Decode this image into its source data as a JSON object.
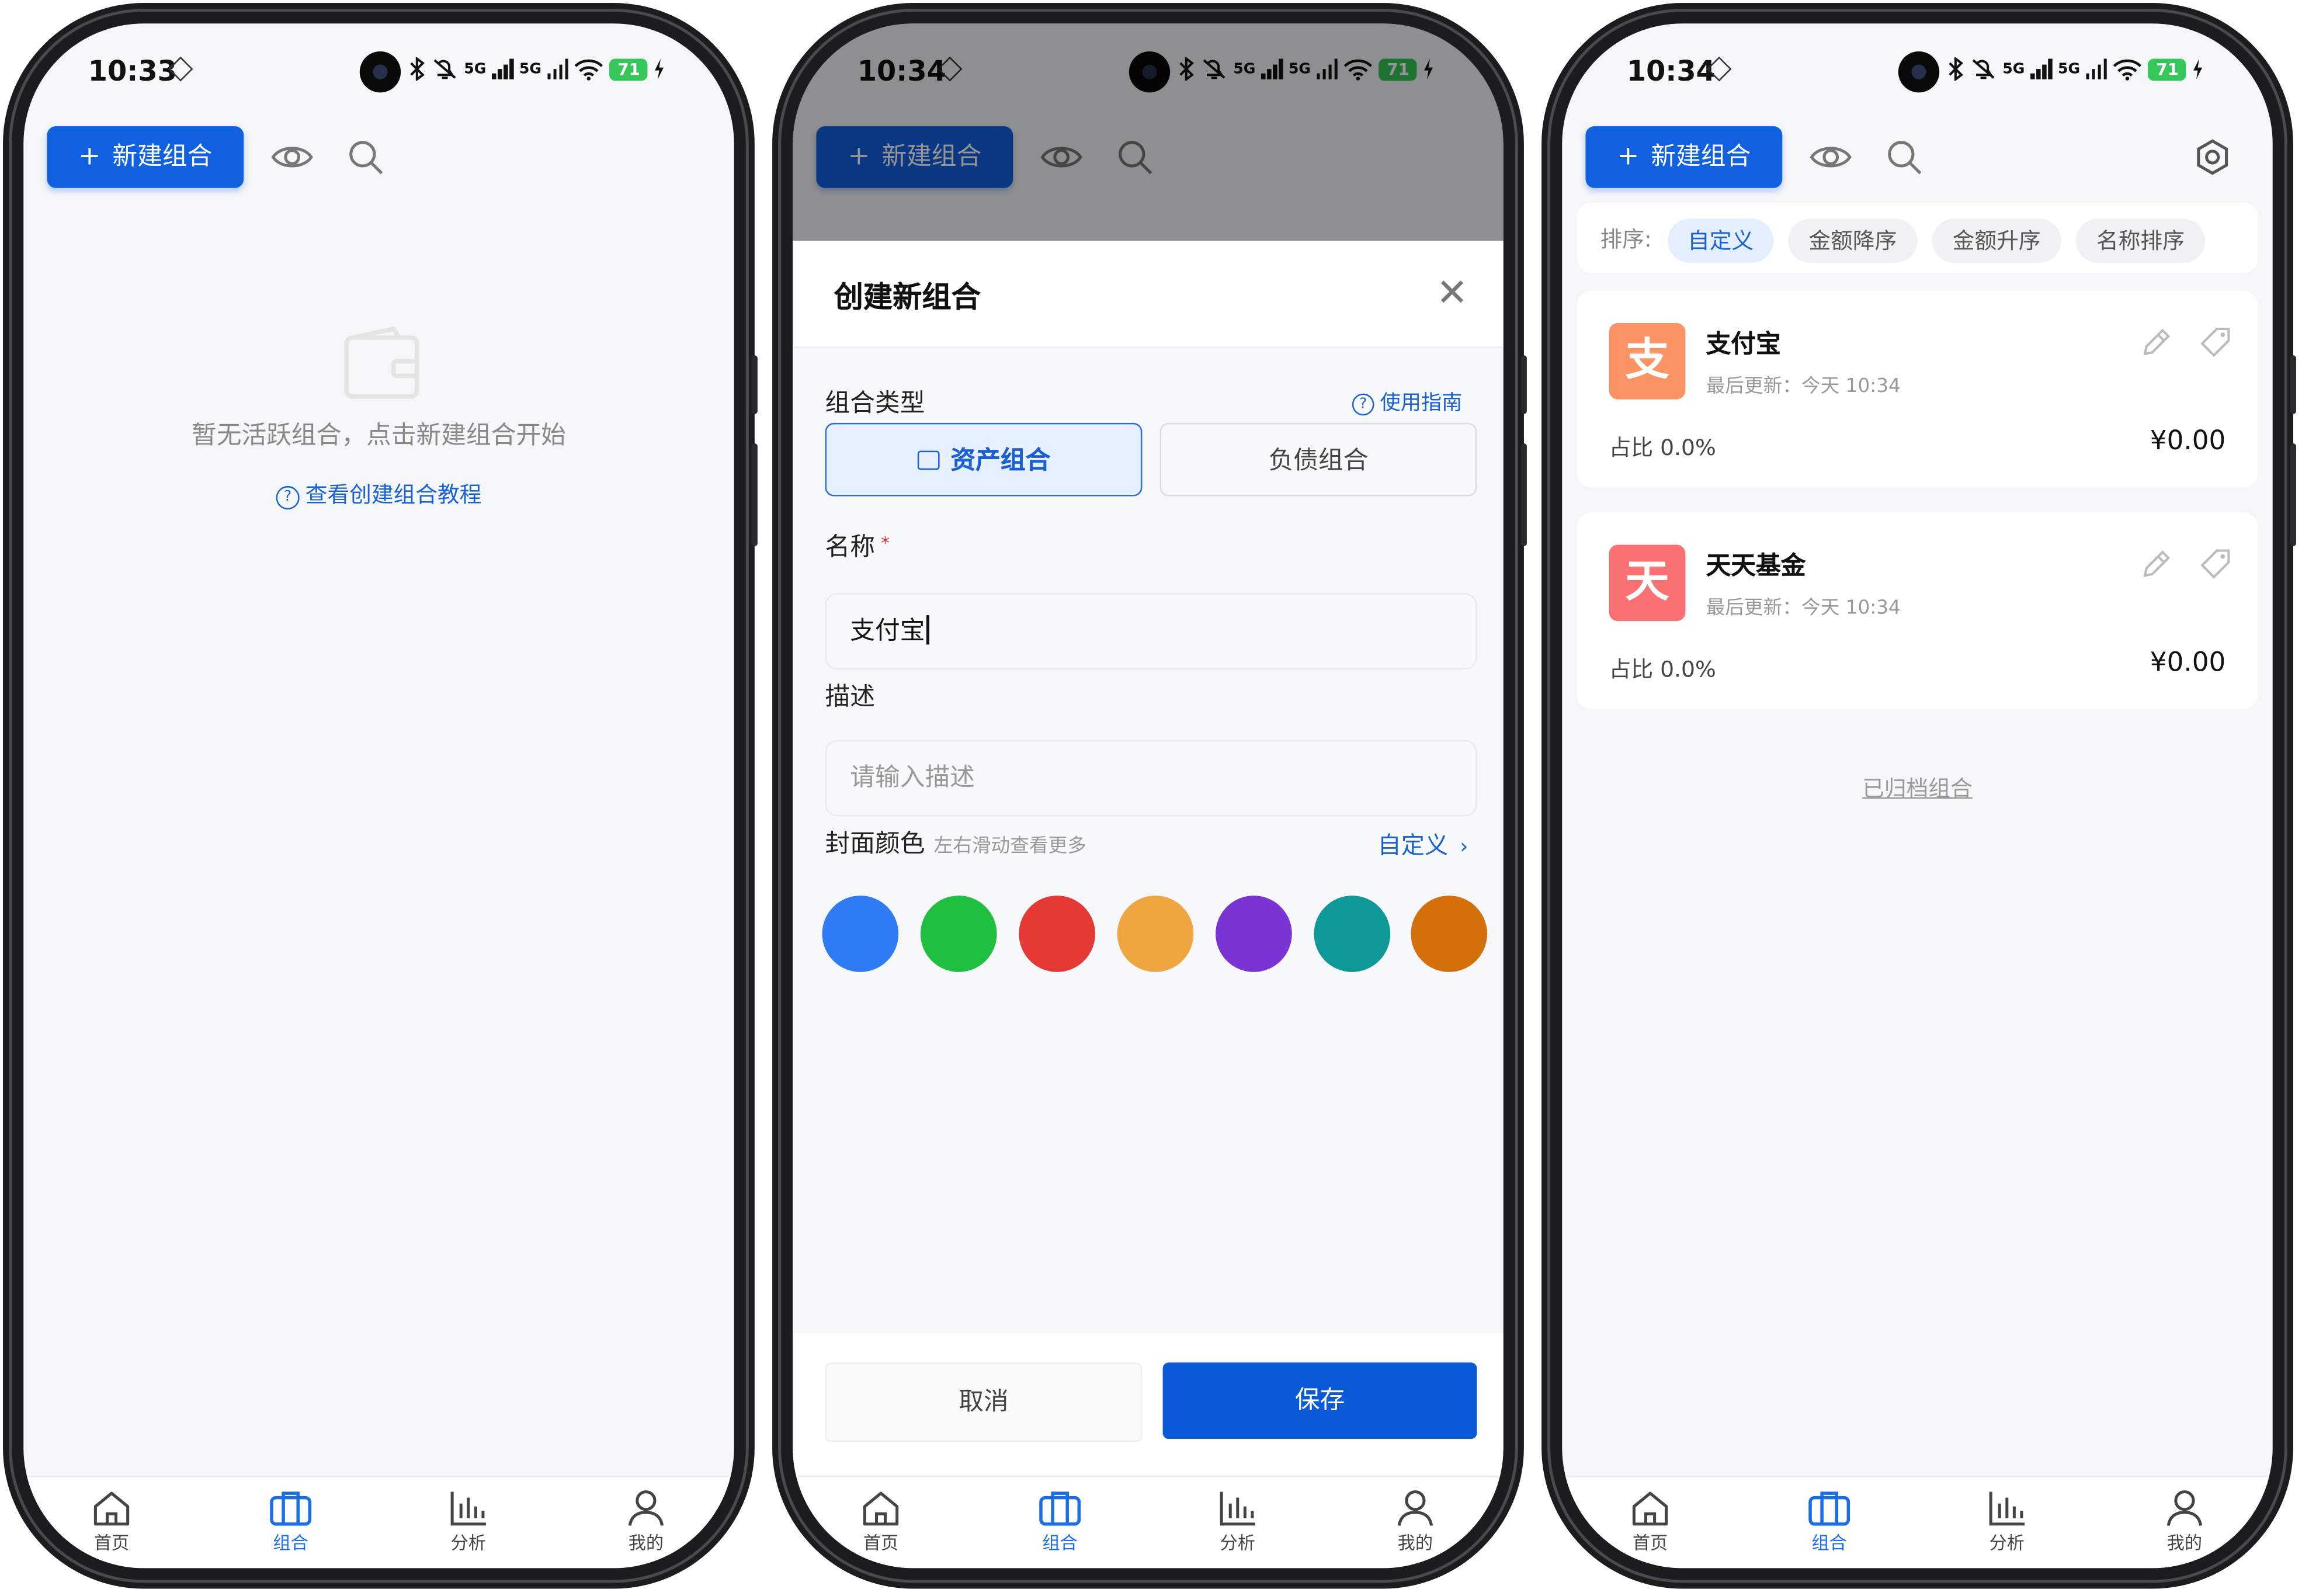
{
  "nav": {
    "home": "首页",
    "portfolio": "组合",
    "analysis": "分析",
    "mine": "我的"
  },
  "colors": {
    "primary": "#1060e0",
    "accent_link": "#1a62d4",
    "active_tab": "#1a6fe8"
  },
  "screen1": {
    "status": {
      "time": "10:33",
      "signal": "5G",
      "battery": "71"
    },
    "new_button": "新建组合",
    "empty_text": "暂无活跃组合，点击新建组合开始",
    "tutorial_link": "查看创建组合教程"
  },
  "screen2": {
    "status": {
      "time": "10:34",
      "signal": "5G",
      "battery": "71"
    },
    "new_button": "新建组合",
    "title": "创建新组合",
    "type_label": "组合类型",
    "guide_link": "使用指南",
    "type_asset": "资产组合",
    "type_liability": "负债组合",
    "name_label": "名称",
    "name_value": "支付宝",
    "desc_label": "描述",
    "desc_placeholder": "请输入描述",
    "color_label": "封面颜色",
    "color_hint": "左右滑动查看更多",
    "custom_link": "自定义",
    "swatches": [
      "#2f7bf5",
      "#1fbf3f",
      "#e53935",
      "#f0a640",
      "#7b34d4",
      "#0f9898",
      "#d4700c"
    ],
    "cancel": "取消",
    "save": "保存"
  },
  "screen3": {
    "status": {
      "time": "10:34",
      "signal": "5G",
      "battery": "71"
    },
    "new_button": "新建组合",
    "sort_label": "排序:",
    "sort_options": [
      "自定义",
      "金额降序",
      "金额升序",
      "名称排序"
    ],
    "cards": [
      {
        "initial": "支",
        "name": "支付宝",
        "updated": "最后更新：今天 10:34",
        "ratio": "占比 0.0%",
        "amount": "¥0.00",
        "color": "#fb9365"
      },
      {
        "initial": "天",
        "name": "天天基金",
        "updated": "最后更新：今天 10:34",
        "ratio": "占比 0.0%",
        "amount": "¥0.00",
        "color": "#fb7070"
      }
    ],
    "archived_link": "已归档组合"
  }
}
